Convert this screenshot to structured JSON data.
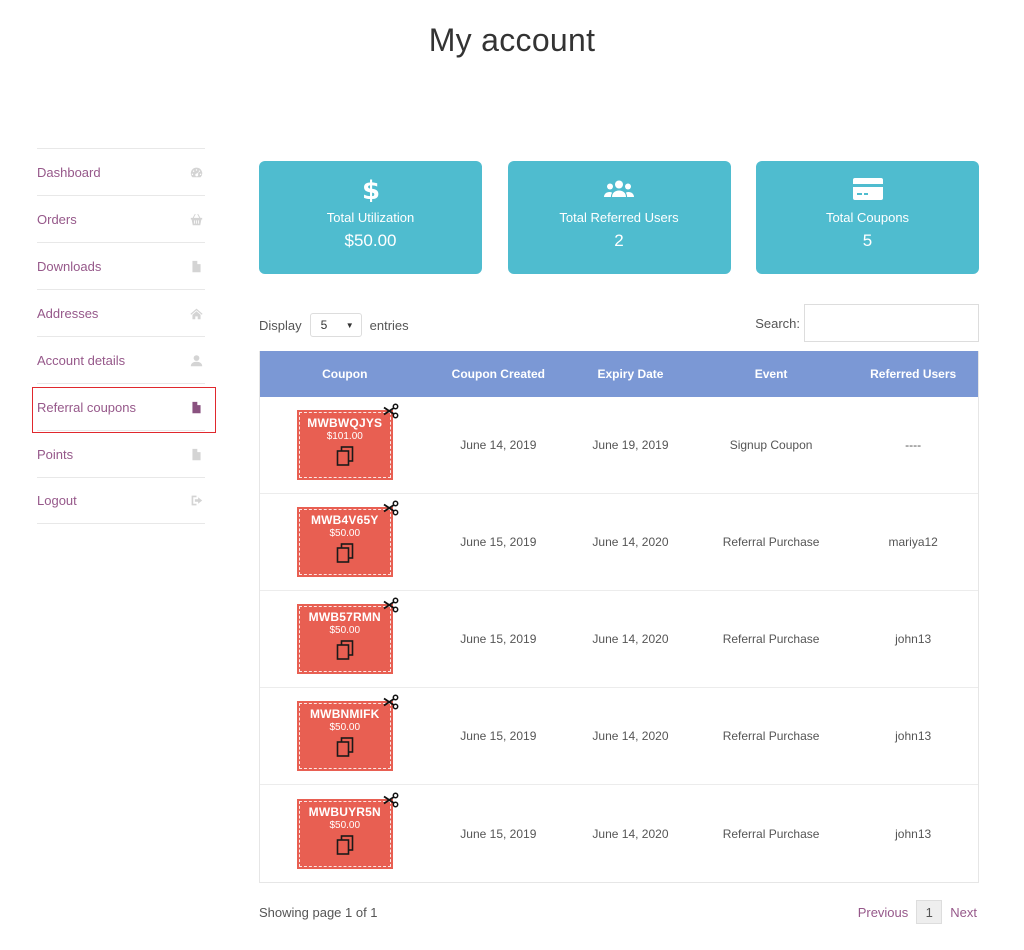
{
  "page": {
    "title": "My account"
  },
  "sidebar": {
    "items": [
      {
        "label": "Dashboard",
        "icon": "dashboard-icon"
      },
      {
        "label": "Orders",
        "icon": "basket-icon"
      },
      {
        "label": "Downloads",
        "icon": "file-icon"
      },
      {
        "label": "Addresses",
        "icon": "home-icon"
      },
      {
        "label": "Account details",
        "icon": "user-icon"
      },
      {
        "label": "Referral coupons",
        "icon": "file-icon",
        "active": true
      },
      {
        "label": "Points",
        "icon": "file-icon"
      },
      {
        "label": "Logout",
        "icon": "logout-icon"
      }
    ]
  },
  "stats": [
    {
      "label": "Total Utilization",
      "value": "$50.00",
      "icon": "dollar-icon"
    },
    {
      "label": "Total Referred Users",
      "value": "2",
      "icon": "users-icon"
    },
    {
      "label": "Total Coupons",
      "value": "5",
      "icon": "credit-card-icon"
    }
  ],
  "controls": {
    "display_label": "Display",
    "entries_value": "5",
    "entries_label": "entries",
    "search_label": "Search:",
    "search_value": ""
  },
  "table": {
    "headers": [
      "Coupon",
      "Coupon Created",
      "Expiry Date",
      "Event",
      "Referred Users"
    ],
    "rows": [
      {
        "code": "MWBWQJYS",
        "amount": "$101.00",
        "created": "June 14, 2019",
        "expiry": "June 19, 2019",
        "event": "Signup Coupon",
        "users": "----"
      },
      {
        "code": "MWB4V65Y",
        "amount": "$50.00",
        "created": "June 15, 2019",
        "expiry": "June 14, 2020",
        "event": "Referral Purchase",
        "users": "mariya12"
      },
      {
        "code": "MWB57RMN",
        "amount": "$50.00",
        "created": "June 15, 2019",
        "expiry": "June 14, 2020",
        "event": "Referral Purchase",
        "users": "john13"
      },
      {
        "code": "MWBNMIFK",
        "amount": "$50.00",
        "created": "June 15, 2019",
        "expiry": "June 14, 2020",
        "event": "Referral Purchase",
        "users": "john13"
      },
      {
        "code": "MWBUYR5N",
        "amount": "$50.00",
        "created": "June 15, 2019",
        "expiry": "June 14, 2020",
        "event": "Referral Purchase",
        "users": "john13"
      }
    ]
  },
  "footer": {
    "showing": "Showing page 1 of 1",
    "previous": "Previous",
    "page": "1",
    "next": "Next"
  },
  "colors": {
    "accent": "#96588a",
    "card": "#4fbccf",
    "table_header": "#7b98d5",
    "coupon": "#e85f52",
    "active_outline": "#e0282d"
  }
}
